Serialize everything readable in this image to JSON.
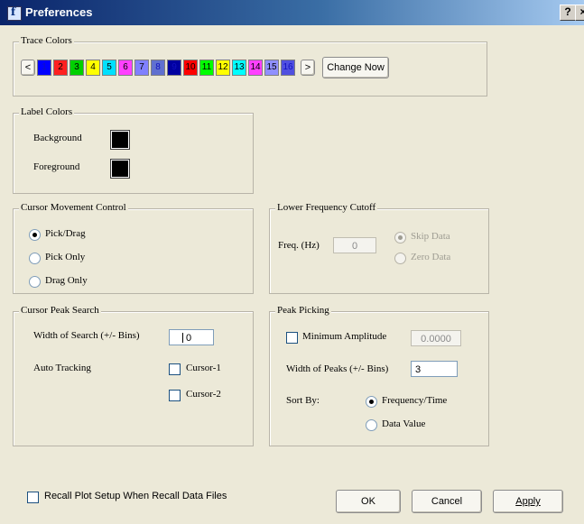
{
  "window": {
    "title": "Preferences",
    "help": "?",
    "close": "×"
  },
  "trace_colors": {
    "legend": "Trace Colors",
    "prev": "<",
    "next": ">",
    "change_now": "Change Now",
    "swatches": [
      {
        "label": "1",
        "color": "#0000ff"
      },
      {
        "label": "2",
        "color": "#ff2020"
      },
      {
        "label": "3",
        "color": "#00d000"
      },
      {
        "label": "4",
        "color": "#ffff00"
      },
      {
        "label": "5",
        "color": "#00e0ff"
      },
      {
        "label": "6",
        "color": "#ff40ff"
      },
      {
        "label": "7",
        "color": "#8080ff"
      },
      {
        "label": "8",
        "color": "#6070d0"
      },
      {
        "label": "9",
        "color": "#0000a0"
      },
      {
        "label": "10",
        "color": "#ff0000"
      },
      {
        "label": "11",
        "color": "#00ff00"
      },
      {
        "label": "12",
        "color": "#ffff00"
      },
      {
        "label": "13",
        "color": "#00ffff"
      },
      {
        "label": "14",
        "color": "#ff40ff"
      },
      {
        "label": "15",
        "color": "#9090ff"
      },
      {
        "label": "16",
        "color": "#5050e0"
      }
    ]
  },
  "label_colors": {
    "legend": "Label Colors",
    "background": "Background",
    "foreground": "Foreground",
    "background_color": "#000000",
    "foreground_color": "#000000"
  },
  "cursor_movement": {
    "legend": "Cursor Movement Control",
    "options": [
      "Pick/Drag",
      "Pick Only",
      "Drag Only"
    ],
    "selected": "Pick/Drag"
  },
  "lower_freq": {
    "legend": "Lower Frequency Cutoff",
    "freq_label": "Freq. (Hz)",
    "freq_value": "0",
    "skip_data": "Skip Data",
    "zero_data": "Zero Data",
    "selected": "Skip Data"
  },
  "cursor_peak": {
    "legend": "Cursor Peak Search",
    "width_label": "Width of Search (+/- Bins)",
    "width_value": "0",
    "auto_tracking": "Auto Tracking",
    "cursor1": "Cursor-1",
    "cursor2": "Cursor-2"
  },
  "peak_picking": {
    "legend": "Peak Picking",
    "min_amp_label": "Minimum Amplitude",
    "min_amp_value": "0.0000",
    "width_label": "Width of Peaks (+/- Bins)",
    "width_value": "3",
    "sort_by": "Sort By:",
    "sort_options": [
      "Frequency/Time",
      "Data Value"
    ],
    "selected": "Frequency/Time"
  },
  "footer": {
    "recall_label": "Recall Plot Setup When Recall Data Files",
    "ok": "OK",
    "cancel": "Cancel",
    "apply": "Apply"
  }
}
